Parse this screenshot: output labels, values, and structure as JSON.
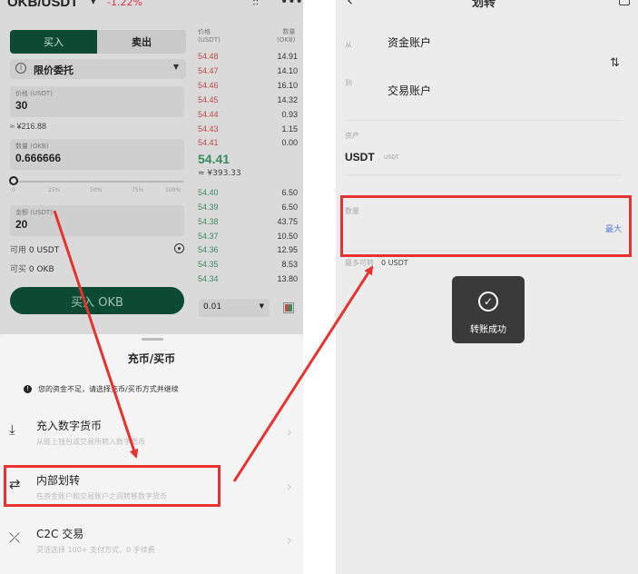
{
  "left": {
    "pair": "OKB/USDT",
    "change": "-1.22%",
    "tabs": {
      "buy": "买入",
      "sell": "卖出"
    },
    "order_type": "限价委托",
    "price": {
      "label": "价格 (USDT)",
      "value": "30",
      "sub": "≈ ¥216.88"
    },
    "amount": {
      "label": "数量 (OKB)",
      "value": "0.666666"
    },
    "slider_marks": [
      "0",
      "25%",
      "50%",
      "75%",
      "100%"
    ],
    "total": {
      "label": "金额 (USDT)",
      "value": "20"
    },
    "available": {
      "label": "可用",
      "value": "0 USDT"
    },
    "can_buy": {
      "label": "可买",
      "value": "0 OKB"
    },
    "buy_button": "买入 OKB",
    "orderbook": {
      "header_price": [
        "价格",
        "(USDT)"
      ],
      "header_qty": [
        "数量",
        "(OKB)"
      ],
      "asks": [
        {
          "p": "54.48",
          "q": "14.91"
        },
        {
          "p": "54.47",
          "q": "14.10"
        },
        {
          "p": "54.46",
          "q": "16.10"
        },
        {
          "p": "54.45",
          "q": "14.32"
        },
        {
          "p": "54.44",
          "q": "0.93"
        },
        {
          "p": "54.43",
          "q": "1.15"
        },
        {
          "p": "54.41",
          "q": "0.00"
        }
      ],
      "mid": "54.41",
      "mid_sub": "≈ ¥393.33",
      "bids": [
        {
          "p": "54.40",
          "q": "6.50"
        },
        {
          "p": "54.39",
          "q": "6.50"
        },
        {
          "p": "54.38",
          "q": "43.75"
        },
        {
          "p": "54.37",
          "q": "10.50"
        },
        {
          "p": "54.36",
          "q": "12.95"
        },
        {
          "p": "54.35",
          "q": "8.53"
        },
        {
          "p": "54.34",
          "q": "13.80"
        }
      ],
      "depth": "0.01"
    },
    "sheet": {
      "title": "充币/买币",
      "notice": "您的资金不足，请选择充币/买币方式并继续",
      "options": [
        {
          "title": "充入数字货币",
          "desc": "从链上钱包或交易所转入数字货币"
        },
        {
          "title": "内部划转",
          "desc": "在资金账户和交易账户之间转移数字货币"
        },
        {
          "title": "C2C 交易",
          "desc": "灵活选择 100+ 支付方式，0 手续费"
        }
      ]
    }
  },
  "right": {
    "title": "划转",
    "from_label": "从",
    "from": "资金账户",
    "to_label": "到",
    "to": "交易账户",
    "asset_label": "资产",
    "asset": "USDT",
    "asset_sub": "USDT",
    "amount_label": "数量",
    "max": "最大",
    "available_label": "最多可转",
    "available_value": "0 USDT",
    "toast": "转账成功"
  },
  "colors": {
    "highlight": "#e8322f",
    "brand": "#0d4a34"
  }
}
